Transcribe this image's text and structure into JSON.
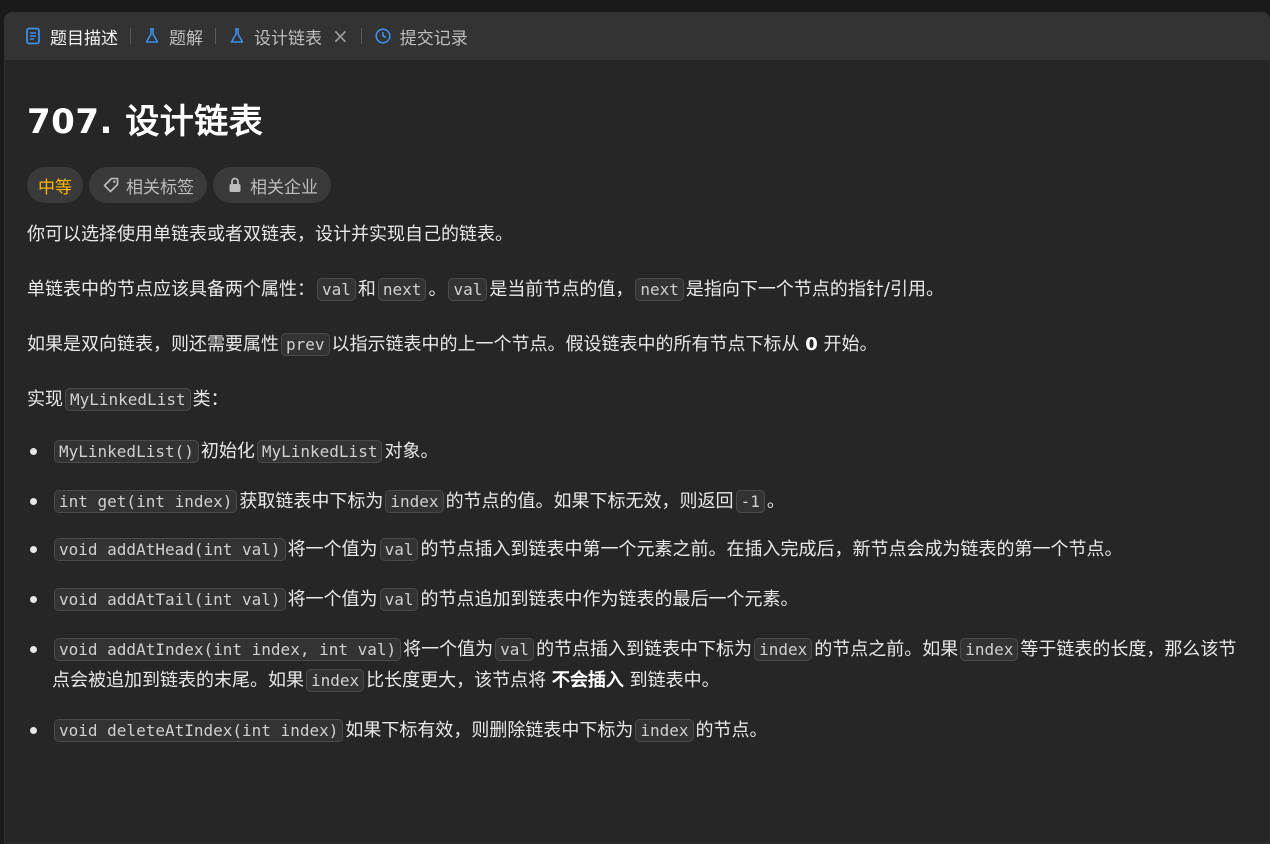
{
  "tabs": [
    {
      "label": "题目描述",
      "icon": "document-icon",
      "active": true
    },
    {
      "label": "题解",
      "icon": "flask-icon",
      "active": false
    },
    {
      "label": "设计链表",
      "icon": "flask-icon",
      "active": false,
      "closable": true
    },
    {
      "label": "提交记录",
      "icon": "history-icon",
      "active": false
    }
  ],
  "problem": {
    "title": "707. 设计链表",
    "difficulty": "中等",
    "difficulty_color": "#ffb800",
    "tag_related_topics": "相关标签",
    "tag_related_companies": "相关企业"
  },
  "description": {
    "p1": "你可以选择使用单链表或者双链表，设计并实现自己的链表。",
    "p2": {
      "t1": "单链表中的节点应该具备两个属性：",
      "c1": "val",
      "t2": "和",
      "c2": "next",
      "t3": "。",
      "c3": "val",
      "t4": "是当前节点的值，",
      "c4": "next",
      "t5": "是指向下一个节点的指针/引用。"
    },
    "p3": {
      "t1": "如果是双向链表，则还需要属性",
      "c1": "prev",
      "t2": "以指示链表中的上一个节点。假设链表中的所有节点下标从",
      "b1": "0",
      "t3": "开始。"
    },
    "p4": {
      "t1": "实现",
      "c1": "MyLinkedList",
      "t2": "类："
    }
  },
  "methods": [
    {
      "c1": "MyLinkedList()",
      "t1": "初始化",
      "c2": "MyLinkedList",
      "t2": "对象。"
    },
    {
      "c1": "int get(int index)",
      "t1": "获取链表中下标为",
      "c2": "index",
      "t2": "的节点的值。如果下标无效，则返回",
      "c3": "-1",
      "t3": "。"
    },
    {
      "c1": "void addAtHead(int val)",
      "t1": "将一个值为",
      "c2": "val",
      "t2": "的节点插入到链表中第一个元素之前。在插入完成后，新节点会成为链表的第一个节点。"
    },
    {
      "c1": "void addAtTail(int val)",
      "t1": "将一个值为",
      "c2": "val",
      "t2": "的节点追加到链表中作为链表的最后一个元素。"
    },
    {
      "c1": "void addAtIndex(int index, int val)",
      "t1": "将一个值为",
      "c2": "val",
      "t2": "的节点插入到链表中下标为",
      "c3": "index",
      "t3": "的节点之前。如果",
      "c4": "index",
      "t4": "等于链表的长度，那么该节点会被追加到链表的末尾。如果",
      "c5": "index",
      "t5": "比长度更大，该节点将",
      "b1": "不会插入",
      "t6": "到链表中。"
    },
    {
      "c1": "void deleteAtIndex(int index)",
      "t1": "如果下标有效，则删除链表中下标为",
      "c2": "index",
      "t2": "的节点。"
    }
  ]
}
